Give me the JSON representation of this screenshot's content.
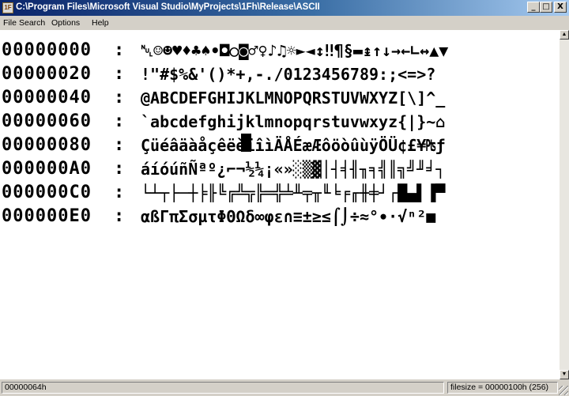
{
  "window": {
    "icon_text": "1F",
    "title": "C:\\Program Files\\Microsoft Visual Studio\\MyProjects\\1Fh\\Release\\ASCII",
    "minimize": "_",
    "maximize": "□",
    "close": "X"
  },
  "menu": {
    "file": "File",
    "search": "Search",
    "options": "Options",
    "help": "Help"
  },
  "dump": {
    "separator": ":",
    "rows": [
      {
        "address": "00000000",
        "chars": "␀☺☻♥♦♣♠•◘○◙♂♀♪♫☼►◄↕‼¶§▬↨↑↓→←∟↔▲▼"
      },
      {
        "address": "00000020",
        "chars": " !\"#$%&'()*+,-./0123456789:;<=>?"
      },
      {
        "address": "00000040",
        "chars": "@ABCDEFGHIJKLMNOPQRSTUVWXYZ[\\]^_"
      },
      {
        "address": "00000060",
        "chars": "`abcdefghijklmnopqrstuvwxyz{|}~⌂"
      },
      {
        "address": "00000080",
        "chars": "ÇüéâäàåçêëèïîìÄÅÉæÆôöòûùÿÖÜ¢£¥₧ƒ"
      },
      {
        "address": "000000A0",
        "chars": "áíóúñÑªº¿⌐¬½¼¡«»░▒▓│┤╡╢╖╕╣║╗╝╜╛┐"
      },
      {
        "address": "000000C0",
        "chars": "└┴┬├─┼╞╟╚╔╩╦╠═╬╧╨╤╥╙╘╒╓╫╪┘┌█▄▌▐▀"
      },
      {
        "address": "000000E0",
        "chars": "αßΓπΣσµτΦΘΩδ∞φε∩≡±≥≤⌠⌡÷≈°∙·√ⁿ²■ "
      }
    ]
  },
  "status": {
    "offset": "00000064h",
    "filesize": "filesize = 00000100h (256)"
  },
  "colors": {
    "title_start": "#0a246a",
    "title_end": "#a6caf0",
    "chrome": "#d4d0c8",
    "client": "#ffffff"
  }
}
